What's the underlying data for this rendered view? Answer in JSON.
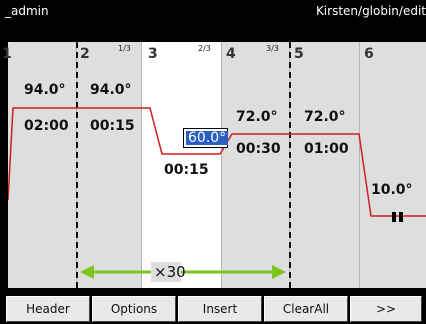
{
  "titlebar": {
    "user": "_admin",
    "path": "Kirsten/globin/edit"
  },
  "steps": [
    {
      "num": "1"
    },
    {
      "num": "2",
      "cycle": "1/3"
    },
    {
      "num": "3",
      "cycle": "2/3"
    },
    {
      "num": "4",
      "cycle": "3/3"
    },
    {
      "num": "5"
    },
    {
      "num": "6"
    }
  ],
  "values": {
    "s1_temp": "94.0°",
    "s1_time": "02:00",
    "s2_temp": "94.0°",
    "s2_time": "00:15",
    "s3_temp": "60.0°",
    "s3_time": "00:15",
    "s4_temp": "72.0°",
    "s4_time": "00:30",
    "s5_temp": "72.0°",
    "s5_time": "01:00",
    "s6_temp": "10.0°"
  },
  "loop": {
    "label": "×30"
  },
  "footer": {
    "header": "Header",
    "options": "Options",
    "insert": "Insert",
    "clearall": "ClearAll",
    "more": ">>"
  },
  "colors": {
    "profile": "#d21f1f",
    "loop_arrow": "#7cc41f",
    "selected_column": "#ffffff",
    "selection": "#2a5fc6"
  }
}
